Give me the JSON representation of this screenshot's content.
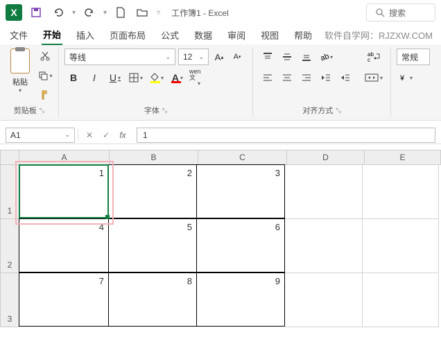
{
  "title": "工作簿1 - Excel",
  "search_placeholder": "搜索",
  "tabs": {
    "file": "文件",
    "home": "开始",
    "insert": "插入",
    "layout": "页面布局",
    "formulas": "公式",
    "data": "数据",
    "review": "审阅",
    "view": "视图",
    "help": "帮助"
  },
  "watermark": "软件自学网：RJZXW.COM",
  "clipboard": {
    "paste": "粘贴",
    "label": "剪贴板"
  },
  "font": {
    "name": "等线",
    "size": "12",
    "bold": "B",
    "italic": "I",
    "underline": "U",
    "wen": "wen 文",
    "label": "字体"
  },
  "align": {
    "label": "对齐方式"
  },
  "number": {
    "format": "常规"
  },
  "namebox": "A1",
  "formula_value": "1",
  "cols": {
    "A": "A",
    "B": "B",
    "C": "C",
    "D": "D",
    "E": "E"
  },
  "rows": {
    "1": "1",
    "2": "2",
    "3": "3"
  },
  "cells": {
    "A1": "1",
    "B1": "2",
    "C1": "3",
    "A2": "4",
    "B2": "5",
    "C2": "6",
    "A3": "7",
    "B3": "8",
    "C3": "9"
  }
}
